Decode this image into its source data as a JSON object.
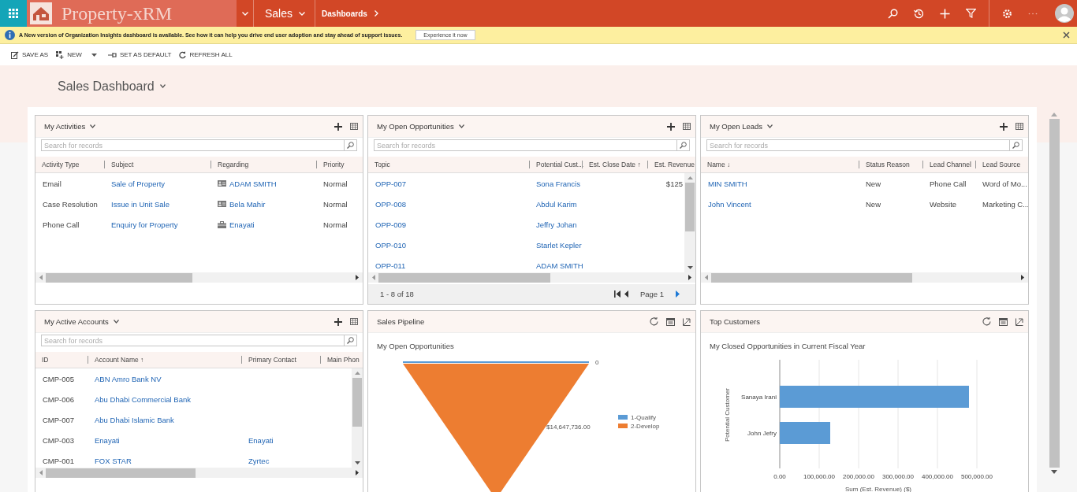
{
  "top_bar": {
    "app_title": "Property-xRM",
    "area": "Sales",
    "breadcrumb": "Dashboards"
  },
  "notification": {
    "message": "A New version of Organization Insights dashboard is available. See how it can help you drive end user adoption and stay ahead of support issues.",
    "button": "Experience it now"
  },
  "commands": [
    {
      "label": "SAVE AS",
      "has_menu": false
    },
    {
      "label": "NEW",
      "has_menu": true
    },
    {
      "label": "SET AS DEFAULT",
      "has_menu": false
    },
    {
      "label": "REFRESH ALL",
      "has_menu": false
    }
  ],
  "dashboard": {
    "title": "Sales Dashboard"
  },
  "panels": [
    {
      "kind": "grid",
      "title": "My Activities",
      "search": {
        "placeholder": "Search for records"
      },
      "columns": [
        {
          "label": "Activity Type"
        },
        {
          "label": "Subject"
        },
        {
          "label": "Regarding"
        },
        {
          "label": "Priority"
        }
      ],
      "rows": [
        [
          {
            "text": "Email",
            "kind": "text"
          },
          {
            "text": "Sale of Property",
            "kind": "link"
          },
          {
            "text": "ADAM SMITH",
            "kind": "contact"
          },
          {
            "text": "Normal",
            "kind": "text"
          }
        ],
        [
          {
            "text": "Case Resolution",
            "kind": "text"
          },
          {
            "text": "Issue in Unit Sale",
            "kind": "link"
          },
          {
            "text": "Bela Mahir",
            "kind": "contact"
          },
          {
            "text": "Normal",
            "kind": "text"
          }
        ],
        [
          {
            "text": "Phone Call",
            "kind": "text"
          },
          {
            "text": "Enquiry for Property",
            "kind": "link"
          },
          {
            "text": "Enayati",
            "kind": "account"
          },
          {
            "text": "Normal",
            "kind": "text"
          }
        ]
      ]
    },
    {
      "kind": "grid",
      "title": "My Open Opportunities",
      "search": {
        "placeholder": "Search for records"
      },
      "columns": [
        {
          "label": "Topic"
        },
        {
          "label": "Potential Cust..."
        },
        {
          "label": "Est. Close Date ↑"
        },
        {
          "label": "Est. Revenue"
        }
      ],
      "rows": [
        [
          {
            "text": "OPP-007",
            "kind": "link"
          },
          {
            "text": "Sona Francis",
            "kind": "link"
          },
          null,
          {
            "text": "$125",
            "kind": "amount"
          }
        ],
        [
          {
            "text": "OPP-008",
            "kind": "link"
          },
          {
            "text": "Abdul Karim",
            "kind": "link"
          },
          null,
          null
        ],
        [
          {
            "text": "OPP-009",
            "kind": "link"
          },
          {
            "text": "Jeffry Johan",
            "kind": "link"
          },
          null,
          null
        ],
        [
          {
            "text": "OPP-010",
            "kind": "link"
          },
          {
            "text": "Starlet Kepler",
            "kind": "link"
          },
          null,
          null
        ],
        [
          {
            "text": "OPP-011",
            "kind": "link"
          },
          {
            "text": "ADAM SMITH",
            "kind": "link"
          },
          null,
          null
        ]
      ],
      "pager": {
        "summary": "1 - 8 of 18",
        "page": "Page 1"
      }
    },
    {
      "kind": "grid",
      "title": "My Open Leads",
      "search": {
        "placeholder": "Search for records"
      },
      "columns": [
        {
          "label": "Name ↓"
        },
        {
          "label": "Status Reason"
        },
        {
          "label": "Lead Channel"
        },
        {
          "label": "Lead Source"
        }
      ],
      "rows": [
        [
          {
            "text": "MIN SMITH",
            "kind": "link"
          },
          {
            "text": "New",
            "kind": "text"
          },
          {
            "text": "Phone Call",
            "kind": "text"
          },
          {
            "text": "Word of Mo...",
            "kind": "text"
          }
        ],
        [
          {
            "text": "John Vincent",
            "kind": "link"
          },
          {
            "text": "New",
            "kind": "text"
          },
          {
            "text": "Website",
            "kind": "text"
          },
          {
            "text": "Marketing C...",
            "kind": "text"
          }
        ]
      ]
    },
    {
      "kind": "grid",
      "title": "My Active Accounts",
      "search": {
        "placeholder": "Search for records"
      },
      "columns": [
        {
          "label": "ID"
        },
        {
          "label": "Account Name ↑"
        },
        {
          "label": "Primary Contact"
        },
        {
          "label": "Main Phon"
        }
      ],
      "rows": [
        [
          {
            "text": "CMP-005",
            "kind": "text"
          },
          {
            "text": "ABN Amro Bank NV",
            "kind": "link"
          },
          null,
          null
        ],
        [
          {
            "text": "CMP-006",
            "kind": "text"
          },
          {
            "text": "Abu Dhabi Commercial Bank",
            "kind": "link"
          },
          null,
          null
        ],
        [
          {
            "text": "CMP-007",
            "kind": "text"
          },
          {
            "text": "Abu Dhabi Islamic Bank",
            "kind": "link"
          },
          null,
          null
        ],
        [
          {
            "text": "CMP-003",
            "kind": "text"
          },
          {
            "text": "Enayati",
            "kind": "link"
          },
          {
            "text": "Enayati",
            "kind": "link"
          },
          null
        ],
        [
          {
            "text": "CMP-001",
            "kind": "text"
          },
          {
            "text": "FOX STAR",
            "kind": "link"
          },
          {
            "text": "Zyrtec",
            "kind": "link"
          },
          null
        ]
      ]
    },
    {
      "kind": "funnel",
      "title": "Sales Pipeline",
      "subtitle": "My Open Opportunities",
      "stages": [
        {
          "name": "1-Qualify",
          "color": "#5b9bd5",
          "label": "0"
        },
        {
          "name": "2-Develop",
          "color": "#ed7d31",
          "label": "$14,647,736.00"
        }
      ]
    },
    {
      "kind": "bar_chart",
      "title": "Top Customers",
      "chart_data": {
        "type": "bar",
        "orientation": "horizontal",
        "title": "My Closed Opportunities in Current Fiscal Year",
        "xlabel": "Sum (Est. Revenue) ($)",
        "ylabel": "Potential Customer",
        "categories": [
          "Sanaya Irani",
          "John Jefry"
        ],
        "series": [
          {
            "color": "#5b9bd5",
            "values": [
              480000,
              128000
            ]
          }
        ],
        "grid": true,
        "xlim": [
          0,
          500000
        ],
        "xticks": [
          {
            "value": 0,
            "label": "0.00"
          },
          {
            "value": 100000,
            "label": "100,000.00"
          },
          {
            "value": 200000,
            "label": "200,000.00"
          },
          {
            "value": 300000,
            "label": "300,000.00"
          },
          {
            "value": 400000,
            "label": "400,000.00"
          },
          {
            "value": 500000,
            "label": "500,000.00"
          }
        ]
      }
    }
  ]
}
